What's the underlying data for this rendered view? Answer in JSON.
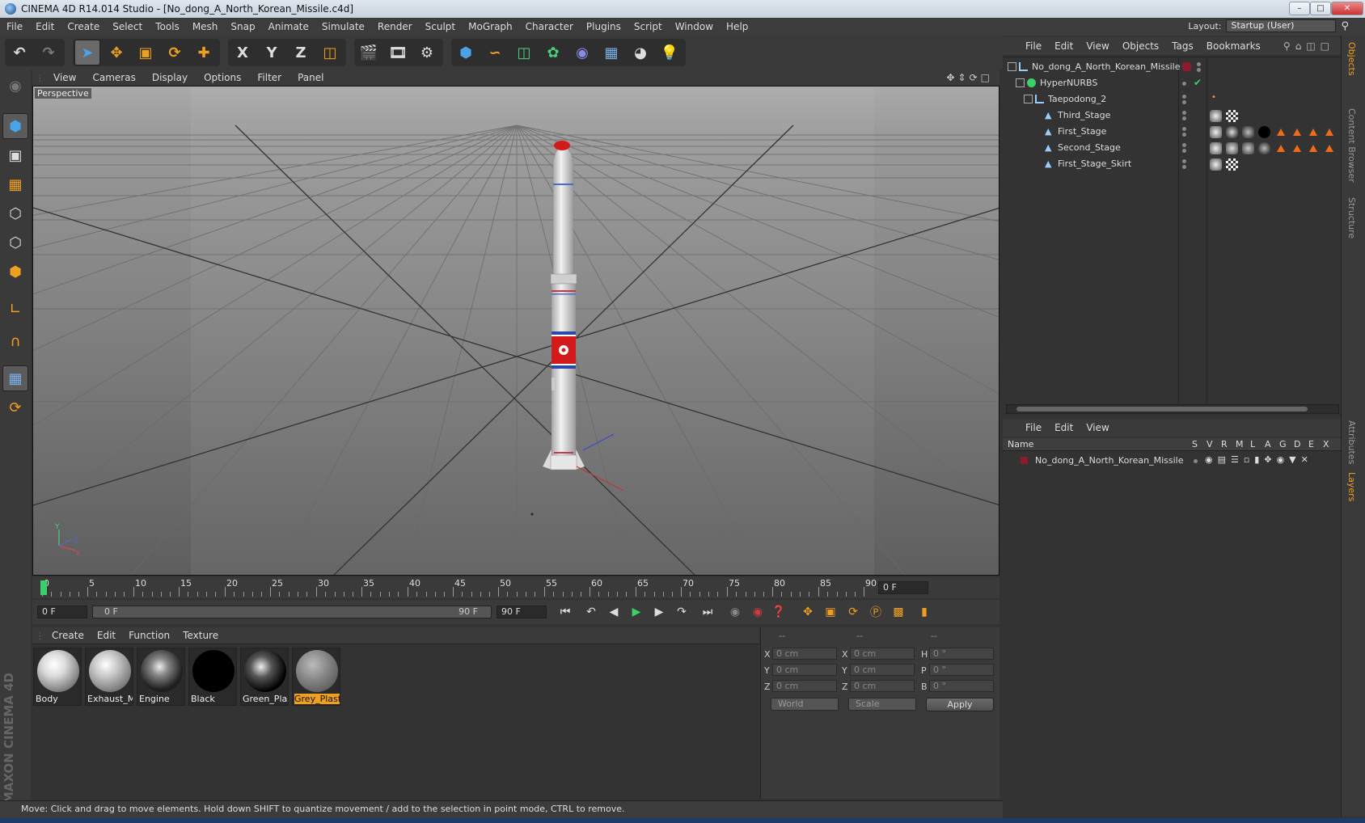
{
  "window": {
    "title": "CINEMA 4D R14.014 Studio - [No_dong_A_North_Korean_Missile.c4d]",
    "buttons": [
      "–",
      "□",
      "✕"
    ]
  },
  "menubar": {
    "items": [
      "File",
      "Edit",
      "Create",
      "Select",
      "Tools",
      "Mesh",
      "Snap",
      "Animate",
      "Simulate",
      "Render",
      "Sculpt",
      "MoGraph",
      "Character",
      "Plugins",
      "Script",
      "Window",
      "Help"
    ],
    "layout_label": "Layout:",
    "layout_value": "Startup (User)"
  },
  "toolbar": {
    "axis_x": "X",
    "axis_y": "Y",
    "axis_z": "Z"
  },
  "viewport": {
    "menu": [
      "View",
      "Cameras",
      "Display",
      "Options",
      "Filter",
      "Panel"
    ],
    "label": "Perspective",
    "axes": {
      "y": "Y",
      "z": "Z",
      "x": "X"
    }
  },
  "timeline": {
    "ticks": [
      "0",
      "5",
      "10",
      "15",
      "20",
      "25",
      "30",
      "35",
      "40",
      "45",
      "50",
      "55",
      "60",
      "65",
      "70",
      "75",
      "80",
      "85",
      "90"
    ],
    "current_frame": "0 F",
    "start_field": "0 F",
    "range_start": "0 F",
    "range_end": "90 F",
    "end_field": "90 F"
  },
  "materials": {
    "menu": [
      "Create",
      "Edit",
      "Function",
      "Texture"
    ],
    "items": [
      {
        "label": "Body",
        "selected": false
      },
      {
        "label": "Exhaust_M",
        "selected": false
      },
      {
        "label": "Engine",
        "selected": false
      },
      {
        "label": "Black",
        "selected": false
      },
      {
        "label": "Green_Plas",
        "selected": false
      },
      {
        "label": "Grey_Plasti",
        "selected": true
      }
    ]
  },
  "coordinates": {
    "header": [
      "--",
      "--",
      "--"
    ],
    "rows": [
      {
        "l1": "X",
        "v1": "0 cm",
        "l2": "X",
        "v2": "0 cm",
        "l3": "H",
        "v3": "0 °"
      },
      {
        "l1": "Y",
        "v1": "0 cm",
        "l2": "Y",
        "v2": "0 cm",
        "l3": "P",
        "v3": "0 °"
      },
      {
        "l1": "Z",
        "v1": "0 cm",
        "l2": "Z",
        "v2": "0 cm",
        "l3": "B",
        "v3": "0 °"
      }
    ],
    "mode": "World",
    "transform": "Scale",
    "apply": "Apply"
  },
  "status": "Move: Click and drag to move elements. Hold down SHIFT to quantize movement / add to the selection in point mode, CTRL to remove.",
  "objects": {
    "menu": [
      "File",
      "Edit",
      "View",
      "Objects",
      "Tags",
      "Bookmarks"
    ],
    "rows": [
      {
        "name": "No_dong_A_North_Korean_Missile",
        "level": 0
      },
      {
        "name": "HyperNURBS",
        "level": 1
      },
      {
        "name": "Taepodong_2",
        "level": 2
      },
      {
        "name": "Third_Stage",
        "level": 3
      },
      {
        "name": "First_Stage",
        "level": 3
      },
      {
        "name": "Second_Stage",
        "level": 3
      },
      {
        "name": "First_Stage_Skirt",
        "level": 3
      }
    ]
  },
  "layers": {
    "menu": [
      "File",
      "Edit",
      "View"
    ],
    "columns": [
      "Name",
      "S",
      "V",
      "R",
      "M",
      "L",
      "A",
      "G",
      "D",
      "E",
      "X"
    ],
    "rows": [
      {
        "name": "No_dong_A_North_Korean_Missile"
      }
    ]
  },
  "side_tabs": [
    "Objects",
    "Content Browser",
    "Structure",
    "Attributes",
    "Layers"
  ],
  "brand": "MAXON CINEMA 4D",
  "colors": {
    "accent": "#f0a020",
    "layer": "#8b1c2c",
    "tri": "#f06a1a"
  }
}
